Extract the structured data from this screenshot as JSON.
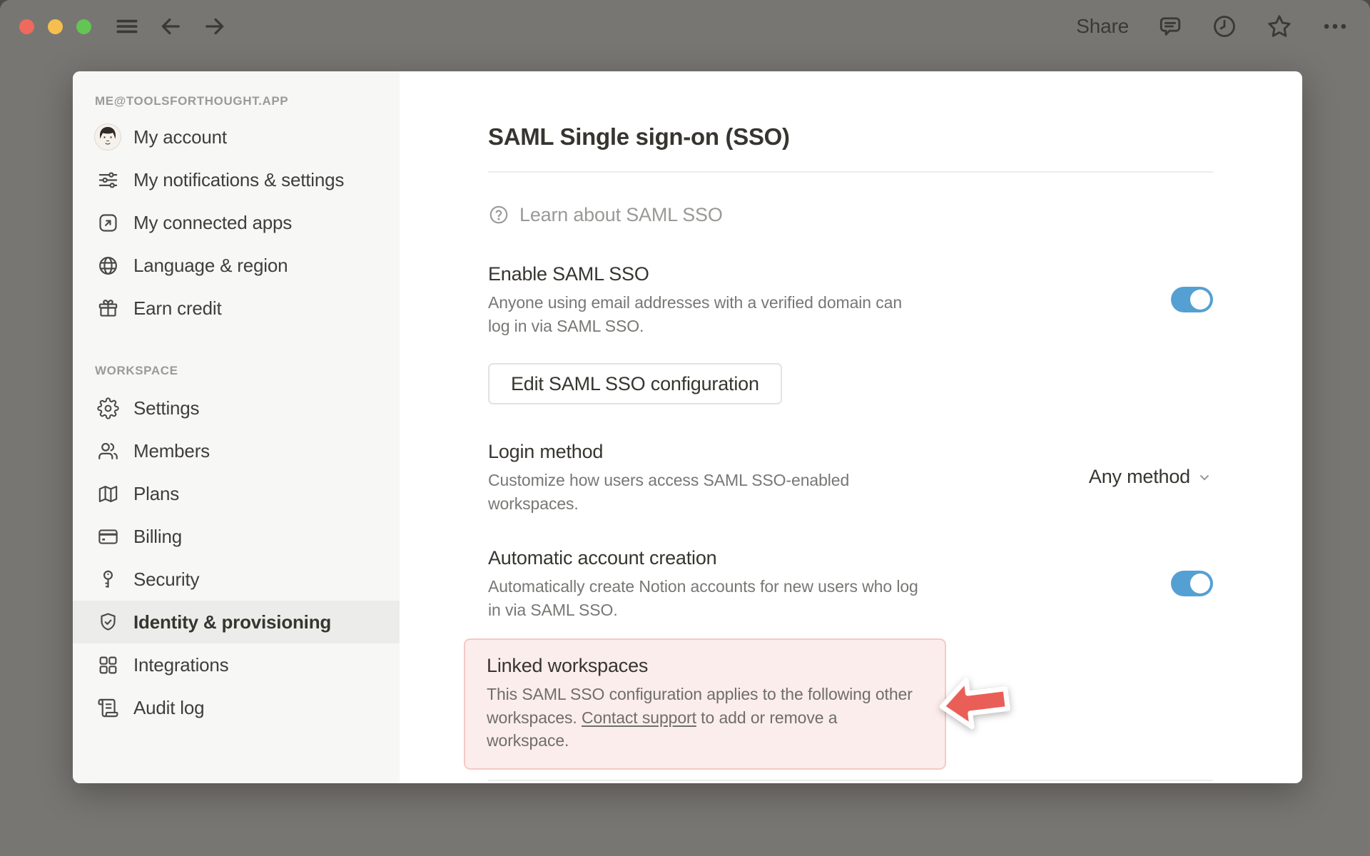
{
  "topbar": {
    "share_label": "Share",
    "icons": [
      "hamburger-icon",
      "back-arrow-icon",
      "forward-arrow-icon",
      "comment-icon",
      "clock-icon",
      "star-icon",
      "more-icon"
    ],
    "traffic_lights": {
      "close": "#ee6a5e",
      "minimize": "#f5be4f",
      "zoom": "#63c554"
    }
  },
  "sidebar": {
    "account_header": "ME@TOOLSFORTHOUGHT.APP",
    "account_items": [
      {
        "label": "My account",
        "icon": "avatar"
      },
      {
        "label": "My notifications & settings",
        "icon": "sliders-icon"
      },
      {
        "label": "My connected apps",
        "icon": "connected-apps-icon"
      },
      {
        "label": "Language & region",
        "icon": "globe-icon"
      },
      {
        "label": "Earn credit",
        "icon": "gift-icon"
      }
    ],
    "workspace_header": "WORKSPACE",
    "workspace_items": [
      {
        "label": "Settings",
        "icon": "gear-icon",
        "selected": false
      },
      {
        "label": "Members",
        "icon": "members-icon",
        "selected": false
      },
      {
        "label": "Plans",
        "icon": "map-icon",
        "selected": false
      },
      {
        "label": "Billing",
        "icon": "credit-card-icon",
        "selected": false
      },
      {
        "label": "Security",
        "icon": "key-icon",
        "selected": false
      },
      {
        "label": "Identity & provisioning",
        "icon": "shield-check-icon",
        "selected": true
      },
      {
        "label": "Integrations",
        "icon": "grid-icon",
        "selected": false
      },
      {
        "label": "Audit log",
        "icon": "scroll-icon",
        "selected": false
      }
    ]
  },
  "main": {
    "title": "SAML Single sign-on (SSO)",
    "learn_label": "Learn about SAML SSO",
    "enable": {
      "heading": "Enable SAML SSO",
      "description": "Anyone using email addresses with a verified domain can log in via SAML SSO.",
      "toggle": "on"
    },
    "edit_button_label": "Edit SAML SSO configuration",
    "login_method": {
      "heading": "Login method",
      "description": "Customize how users access SAML SSO-enabled workspaces.",
      "value": "Any method"
    },
    "auto_account": {
      "heading": "Automatic account creation",
      "description": "Automatically create Notion accounts for new users who log in via SAML SSO.",
      "toggle": "on"
    },
    "linked": {
      "heading": "Linked workspaces",
      "text_before": "This SAML SSO configuration applies to the following other workspaces. ",
      "link_text": "Contact support",
      "text_after": " to add or remove a workspace."
    }
  },
  "colors": {
    "accent_toggle": "#54a0d3",
    "callout_bg": "#fbedec",
    "callout_border": "#f5c9c4",
    "annotation_arrow": "#e95f57",
    "window_bg": "#787672",
    "sidebar_bg": "#f7f7f5",
    "selected_item_bg": "#ececea",
    "text_dark": "#37352f",
    "text_gray": "#787774"
  }
}
